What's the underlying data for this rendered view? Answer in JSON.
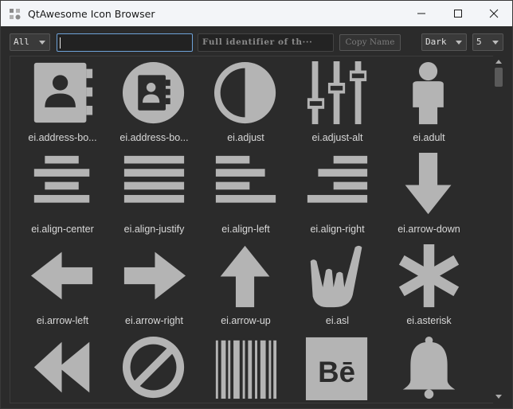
{
  "window": {
    "title": "QtAwesome Icon Browser",
    "controls": [
      "minimize-icon",
      "maximize-icon",
      "close-icon"
    ]
  },
  "toolbar": {
    "font_filter": "All",
    "search_value": "",
    "identifier_placeholder": "Full identifier of th···",
    "copy_label": "Copy Name",
    "theme": "Dark",
    "columns": "5"
  },
  "icons": [
    {
      "label": "ei.address-bo...",
      "icon": "address-book-icon"
    },
    {
      "label": "ei.address-bo...",
      "icon": "address-book-alt-icon"
    },
    {
      "label": "ei.adjust",
      "icon": "adjust-icon"
    },
    {
      "label": "ei.adjust-alt",
      "icon": "adjust-alt-icon"
    },
    {
      "label": "ei.adult",
      "icon": "adult-icon"
    },
    {
      "label": "ei.align-center",
      "icon": "align-center-icon"
    },
    {
      "label": "ei.align-justify",
      "icon": "align-justify-icon"
    },
    {
      "label": "ei.align-left",
      "icon": "align-left-icon"
    },
    {
      "label": "ei.align-right",
      "icon": "align-right-icon"
    },
    {
      "label": "ei.arrow-down",
      "icon": "arrow-down-icon"
    },
    {
      "label": "ei.arrow-left",
      "icon": "arrow-left-icon"
    },
    {
      "label": "ei.arrow-right",
      "icon": "arrow-right-icon"
    },
    {
      "label": "ei.arrow-up",
      "icon": "arrow-up-icon"
    },
    {
      "label": "ei.asl",
      "icon": "asl-icon"
    },
    {
      "label": "ei.asterisk",
      "icon": "asterisk-icon"
    },
    {
      "label": "",
      "icon": "backward-icon"
    },
    {
      "label": "",
      "icon": "ban-circle-icon"
    },
    {
      "label": "",
      "icon": "barcode-icon"
    },
    {
      "label": "",
      "icon": "behance-icon"
    },
    {
      "label": "",
      "icon": "bell-icon"
    }
  ],
  "colors": {
    "background": "#2b2b2b",
    "icon_fill": "#b4b4b4",
    "label": "#d8d8d8",
    "titlebar": "#f3f5f8",
    "focus_border": "#6ea2d8"
  }
}
